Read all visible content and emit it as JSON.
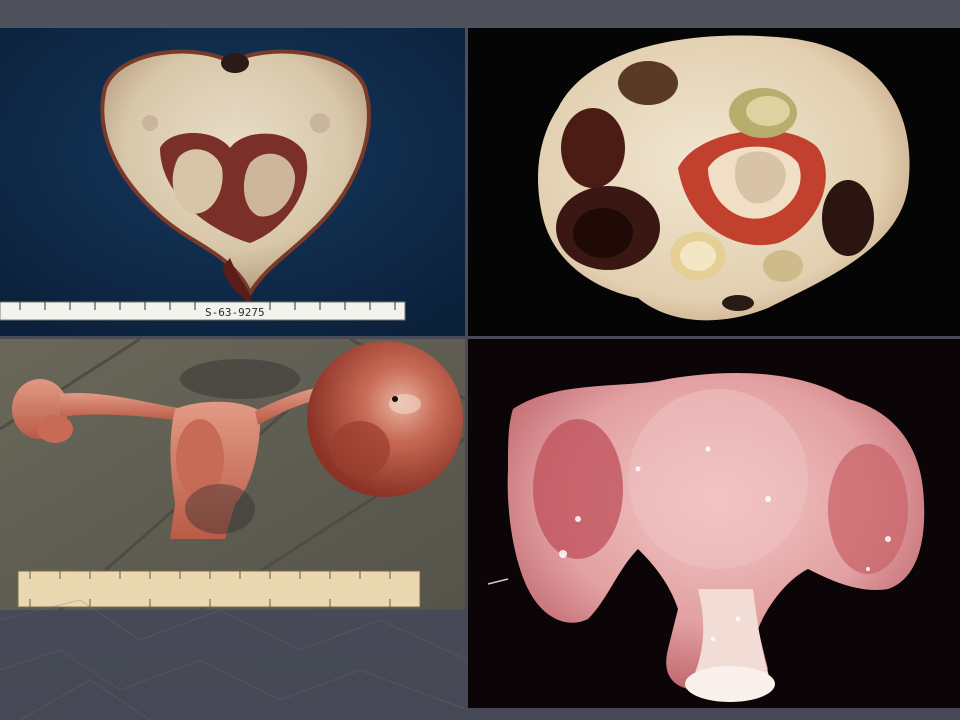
{
  "slide": {
    "background_color": "#4a4d58",
    "panels": [
      {
        "id": "top-left",
        "kind": "photo",
        "background": "#0f2a4a"
      },
      {
        "id": "top-right",
        "kind": "photo",
        "background": "#060606"
      },
      {
        "id": "bottom-left",
        "kind": "photo",
        "background": "#5f5c50"
      },
      {
        "id": "bottom-right",
        "kind": "photo",
        "background": "#0a0406"
      }
    ],
    "ruler_label": "S-63-9275"
  }
}
